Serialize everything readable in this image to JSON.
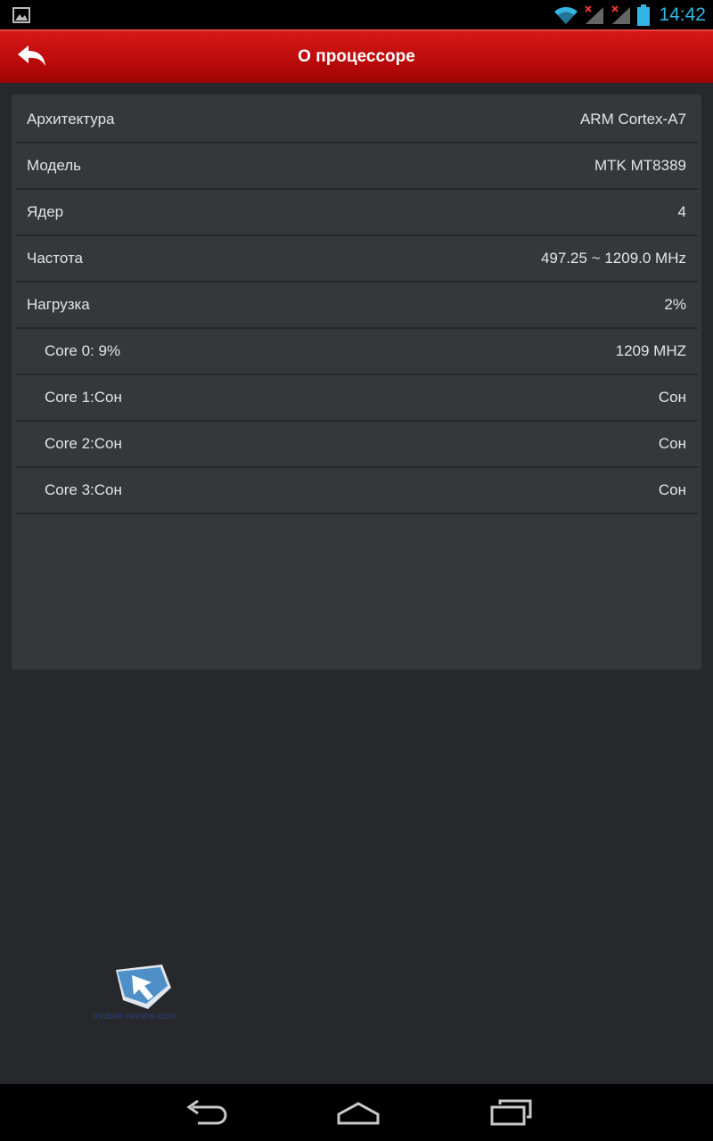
{
  "status_bar": {
    "time": "14:42",
    "icons": [
      "gallery-notification-icon",
      "wifi-icon",
      "signal-1-no-sim-icon",
      "signal-2-no-sim-icon",
      "battery-icon"
    ]
  },
  "action_bar": {
    "title": "О процессоре",
    "back_icon": "back-arrow-icon"
  },
  "rows": [
    {
      "label": "Архитектура",
      "value": "ARM Cortex-A7"
    },
    {
      "label": "Модель",
      "value": "MTK MT8389"
    },
    {
      "label": "Ядер",
      "value": "4"
    },
    {
      "label": "Частота",
      "value": "497.25 ~ 1209.0 MHz"
    },
    {
      "label": "Нагрузка",
      "value": "2%"
    },
    {
      "label": "Core 0: 9%",
      "value": "1209 MHZ"
    },
    {
      "label": "Core 1:Сон",
      "value": "Сон"
    },
    {
      "label": "Core 2:Сон",
      "value": "Сон"
    },
    {
      "label": "Core 3:Сон",
      "value": "Сон"
    }
  ],
  "watermark": {
    "text": "mobile-review.com"
  },
  "nav_bar": {
    "icons": [
      "back-icon",
      "home-icon",
      "recent-apps-icon"
    ]
  },
  "colors": {
    "accent_red": "#c20e0e",
    "clock_blue": "#33b5e5",
    "card_bg": "#36373b",
    "page_bg": "#27282b"
  }
}
